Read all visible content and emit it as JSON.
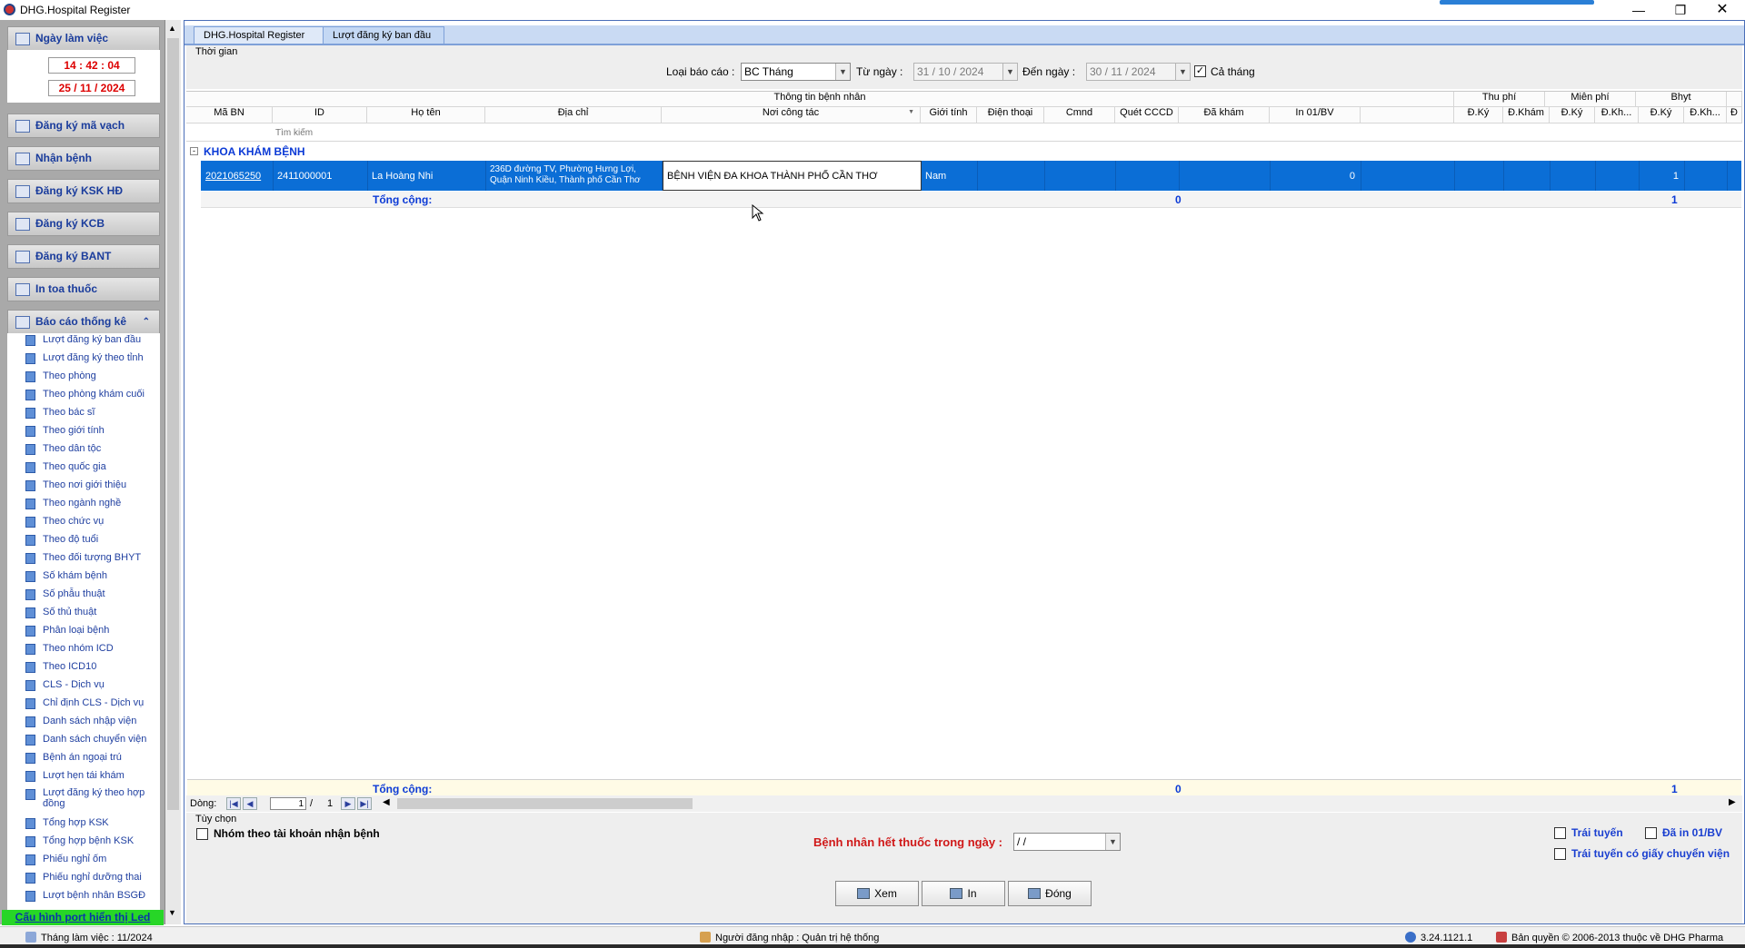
{
  "window": {
    "title": "DHG.Hospital Register"
  },
  "sidebar": {
    "ngay_lam_viec": "Ngày làm việc",
    "time": "14 : 42 : 04",
    "date": "25 / 11 / 2024",
    "menu": [
      "Đăng ký mã vạch",
      "Nhận bệnh",
      "Đăng ký KSK HĐ",
      "Đăng ký KCB",
      "Đăng ký BANT",
      "In toa thuốc"
    ],
    "bao_cao_header": "Báo cáo thống kê",
    "bao_cao_items": [
      "Lượt đăng ký ban đầu",
      "Lượt đăng ký theo tỉnh",
      "Theo phòng",
      "Theo phòng khám cuối",
      "Theo bác sĩ",
      "Theo giới tính",
      "Theo dân tộc",
      "Theo quốc gia",
      "Theo nơi giới thiệu",
      "Theo ngành nghề",
      "Theo chức vụ",
      "Theo độ tuổi",
      "Theo đối tượng BHYT",
      "Số khám bệnh",
      "Số phẫu thuật",
      "Số thủ thuật",
      "Phân loại bệnh",
      "Theo nhóm ICD",
      "Theo ICD10",
      "CLS - Dịch vụ",
      "Chỉ định CLS - Dịch vụ",
      "Danh sách nhập viện",
      "Danh sách chuyển viện",
      "Bệnh án ngoại trú",
      "Lượt hẹn tái khám",
      "Lượt đăng ký theo hợp đồng",
      "Tổng hợp KSK",
      "Tổng hợp bệnh KSK",
      "Phiếu nghỉ ốm",
      "Phiếu nghỉ dưỡng thai",
      "Lượt bệnh nhân BSGĐ"
    ],
    "cau_hinh": "Cấu hình port hiển thị Led"
  },
  "tabs": [
    "DHG.Hospital Register",
    "Lượt đăng ký ban đầu"
  ],
  "filter": {
    "thoi_gian": "Thời gian",
    "loai_bao_cao_label": "Loại báo cáo :",
    "loai_bao_cao_value": "BC Tháng",
    "tu_ngay_label": "Từ ngày :",
    "tu_ngay_value": "31 / 10 / 2024",
    "den_ngay_label": "Đến ngày :",
    "den_ngay_value": "30 / 11 / 2024",
    "ca_thang_label": "Cả tháng",
    "ca_thang_checked": true
  },
  "grid": {
    "band_thong_tin": "Thông tin bệnh nhân",
    "band_thu_phi": "Thu phí",
    "band_mien_phi": "Miễn phí",
    "band_bhyt": "Bhyt",
    "columns": [
      "Mã BN",
      "ID",
      "Họ tên",
      "Địa chỉ",
      "Nơi công tác",
      "Giới tính",
      "Điện thoại",
      "Cmnd",
      "Quét CCCD",
      "Đã khám",
      "In 01/BV",
      "",
      "Đ.Ký",
      "Đ.Khám",
      "Đ.Ký",
      "Đ.Kh...",
      "Đ.Ký",
      "Đ.Kh...",
      "Đ"
    ],
    "search_placeholder": "Tìm kiếm",
    "group": "KHOA KHÁM BỆNH",
    "row": {
      "ma_bn": "2021065250",
      "id": "2411000001",
      "ho_ten": "La Hoàng Nhi",
      "dia_chi_1": "236D đường TV, Phường Hưng Lợi,",
      "dia_chi_2": "Quận Ninh Kiều, Thành phố Cần Thơ",
      "noi_cong_tac": "BỆNH VIỆN ĐA KHOA THÀNH PHỐ CẦN THƠ",
      "gioi_tinh": "Nam",
      "in_01bv": "0",
      "bhyt_dky": "1"
    },
    "tong_cong_label": "Tổng cộng:",
    "tong_da_kham": "0",
    "tong_bhyt": "1"
  },
  "nav": {
    "dong_label": "Dòng:",
    "page": "1",
    "of": "/",
    "total": "1"
  },
  "options": {
    "tuy_chon": "Tùy chọn",
    "nhom_tk": "Nhóm theo tài khoản nhận bệnh",
    "het_thuoc_label": "Bệnh nhân hết thuốc trong ngày :",
    "het_thuoc_value": "  /    /",
    "trai_tuyen": "Trái tuyến",
    "da_in": "Đã in 01/BV",
    "trai_tuyen_gcv": "Trái tuyến có giấy chuyển viện"
  },
  "buttons": {
    "xem": "Xem",
    "in": "In",
    "dong": "Đóng"
  },
  "status": {
    "thang": "Tháng làm việc : 11/2024",
    "user": "Người đăng nhập : Quản trị hệ thống",
    "version": "3.24.1121.1",
    "copyright": "Bản quyền © 2006-2013 thuộc về DHG Pharma"
  }
}
